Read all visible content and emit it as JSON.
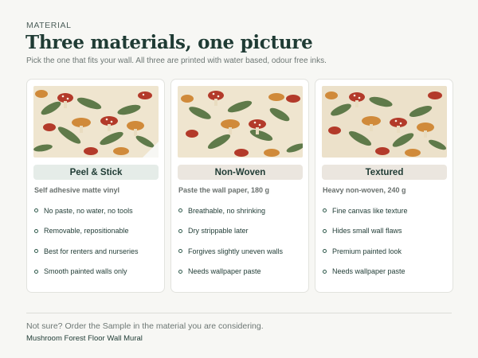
{
  "header": {
    "eyebrow": "MATERIAL",
    "title": "Three materials, one picture",
    "subtitle": "Pick the one that fits your wall. All three are printed with water based, odour free inks."
  },
  "cards": [
    {
      "name": "Peel & Stick",
      "spec": "Self adhesive matte vinyl",
      "features": [
        "No paste, no water, no tools",
        "Removable, repositionable",
        "Best for renters and nurseries",
        "Smooth painted walls only"
      ]
    },
    {
      "name": "Non-Woven",
      "spec": "Paste the wall paper, 180 g",
      "features": [
        "Breathable, no shrinking",
        "Dry strippable later",
        "Forgives slightly uneven walls",
        "Needs wallpaper paste"
      ]
    },
    {
      "name": "Textured",
      "spec": "Heavy non-woven, 240 g",
      "features": [
        "Fine canvas like texture",
        "Hides small wall flaws",
        "Premium painted look",
        "Needs wallpaper paste"
      ]
    }
  ],
  "footer": {
    "note": "Not sure? Order the Sample in the material you are considering.",
    "product": "Mushroom Forest Floor Wall Mural"
  },
  "colors": {
    "accent": "#1f3b34",
    "pill_selected": "#e5ece8",
    "pill_default": "#ebe6df",
    "background": "#f7f7f4"
  }
}
